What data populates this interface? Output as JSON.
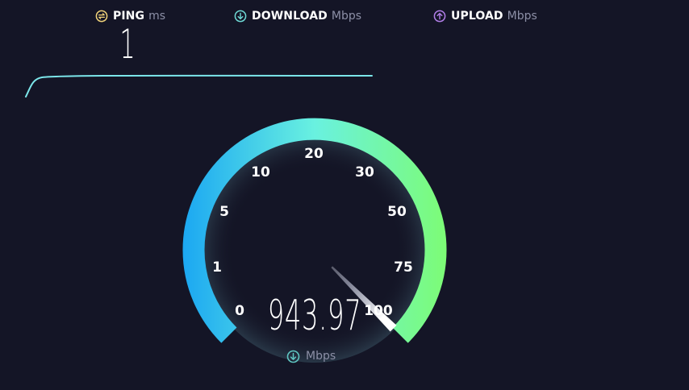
{
  "header": {
    "ping": {
      "label": "PING",
      "unit": "ms",
      "icon": "ping-icon",
      "color": "#f1d37a",
      "value": "1"
    },
    "download": {
      "label": "DOWNLOAD",
      "unit": "Mbps",
      "icon": "download-arrow-icon",
      "color": "#6fdad6"
    },
    "upload": {
      "label": "UPLOAD",
      "unit": "Mbps",
      "icon": "upload-arrow-icon",
      "color": "#b27fe9"
    }
  },
  "gauge": {
    "value": "943.97",
    "unit": "Mbps",
    "unit_icon": "download-arrow-icon",
    "scale_labels": [
      "0",
      "1",
      "5",
      "10",
      "20",
      "30",
      "50",
      "75",
      "100"
    ],
    "needle_level": 100,
    "colors": {
      "gradient_start": "#1ba7f2",
      "gradient_mid": "#69f1e0",
      "gradient_end": "#7dfc75",
      "ping_line": "#7ce6ea"
    }
  }
}
